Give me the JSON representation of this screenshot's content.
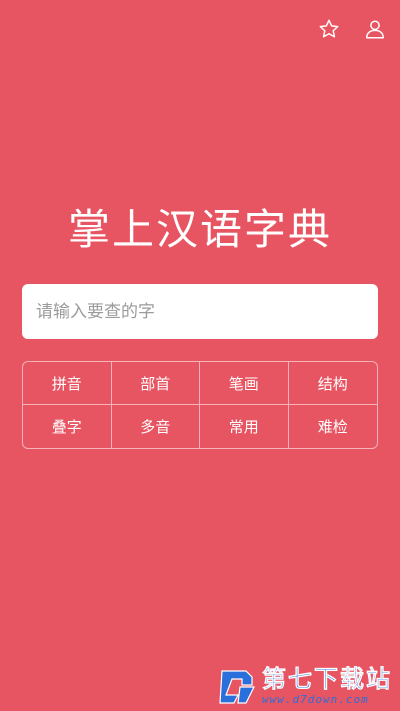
{
  "header": {
    "favorite_icon": "star-icon",
    "profile_icon": "user-icon"
  },
  "app": {
    "title": "掌上汉语字典"
  },
  "search": {
    "placeholder": "请输入要查的字",
    "value": ""
  },
  "categories": [
    {
      "label": "拼音"
    },
    {
      "label": "部首"
    },
    {
      "label": "笔画"
    },
    {
      "label": "结构"
    },
    {
      "label": "叠字"
    },
    {
      "label": "多音"
    },
    {
      "label": "常用"
    },
    {
      "label": "难检"
    }
  ],
  "watermark": {
    "text": "第七下载站",
    "url": "www.d7down.com"
  },
  "colors": {
    "background": "#e85562",
    "text": "#ffffff",
    "watermark": "#2a6fdb"
  }
}
